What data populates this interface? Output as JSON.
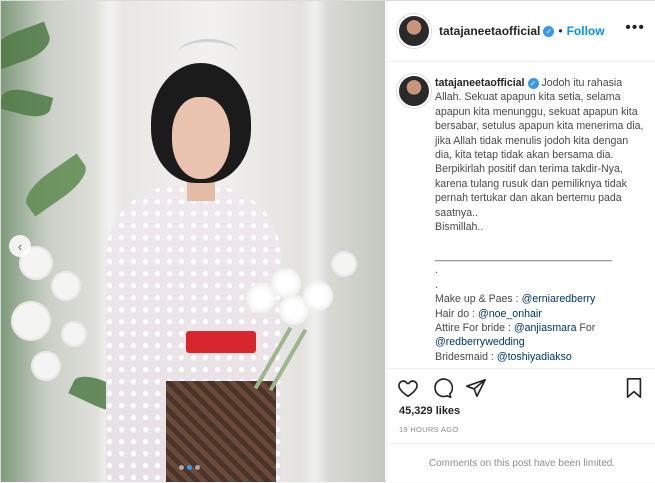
{
  "post": {
    "username": "tatajaneetaofficial",
    "follow_label": "Follow",
    "dot": "•",
    "more": "•••",
    "caption_lines": [
      "Jodoh itu rahasia Allah. Sekuat apapun kita setia, selama apapun kita menunggu, sekuat apapun kita bersabar, setulus apapun kita menerima dia, jika Allah tidak menulis jodoh kita dengan dia, kita tetap tidak akan bersama dia.",
      "Berpikirlah positif dan terima takdir-Nya, karena tulang rusuk dan pemiliknya tidak pernah tertukar dan akan bertemu pada saatnya..",
      "Bismillah..",
      "",
      "______________________________",
      ".",
      ".",
      "Make up & Paes : @erniaredberry",
      "Hair do : @noe_onhair",
      "Attire For bride : @anjiasmara For @redberrywedding",
      "Bridesmaid : @toshiyadiakso"
    ],
    "likes": "45,329 likes",
    "time": "19 HOURS AGO",
    "comments_limited": "Comments on this post have been limited."
  },
  "icons": {
    "like": "heart-icon",
    "comment": "comment-icon",
    "share": "share-icon",
    "save": "bookmark-icon",
    "verified": "verified-badge-icon",
    "prev": "chevron-left-icon"
  },
  "colors": {
    "accent": "#0095f6",
    "verified": "#3897f0",
    "mention": "#00376b",
    "muted": "#8e8e8e"
  }
}
